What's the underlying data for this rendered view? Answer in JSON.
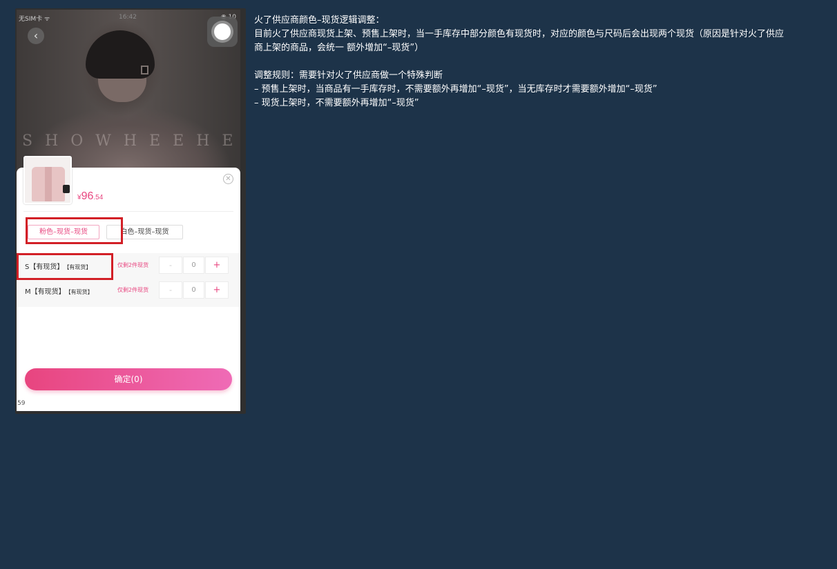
{
  "status_bar": {
    "carrier": "无SIM卡",
    "wifi_icon": "wifi-icon",
    "time": "16:42",
    "right": "10"
  },
  "product": {
    "price_currency": "¥",
    "price_int": "96",
    "price_dec": ".54",
    "watermark": "SHOWHEEHEE"
  },
  "colors": [
    {
      "label": "粉色–现货–现货",
      "selected": true
    },
    {
      "label": "白色–现货–现货",
      "selected": false
    }
  ],
  "sizes": [
    {
      "label": "S【有现货】",
      "tag": "【有现货】",
      "stock_note": "仅剩2件现货",
      "minus": "-",
      "qty": "0",
      "plus": "+"
    },
    {
      "label": "M【有现货】",
      "tag": "【有现货】",
      "stock_note": "仅剩2件现货",
      "minus": "-",
      "qty": "0",
      "plus": "+"
    }
  ],
  "confirm_label": "确定(0)",
  "corner_number": "59",
  "highlight_color": "#d21f26",
  "accent_color": "#e8457f",
  "notes": {
    "title": "火了供应商颜色–现货逻辑调整：",
    "line1": "目前火了供应商现货上架、预售上架时，当一手库存中部分颜色有现货时，对应的颜色与尺码后会出现两个现货（原因是针对火了供应",
    "line2": "商上架的商品，会统一 额外增加“–现货”）",
    "rule_title": "调整规则：需要针对火了供应商做一个特殊判断",
    "rule1": "– 预售上架时，当商品有一手库存时，不需要额外再增加“–现货”，当无库存时才需要额外增加“–现货”",
    "rule2": "– 现货上架时，不需要额外再增加“–现货”"
  }
}
